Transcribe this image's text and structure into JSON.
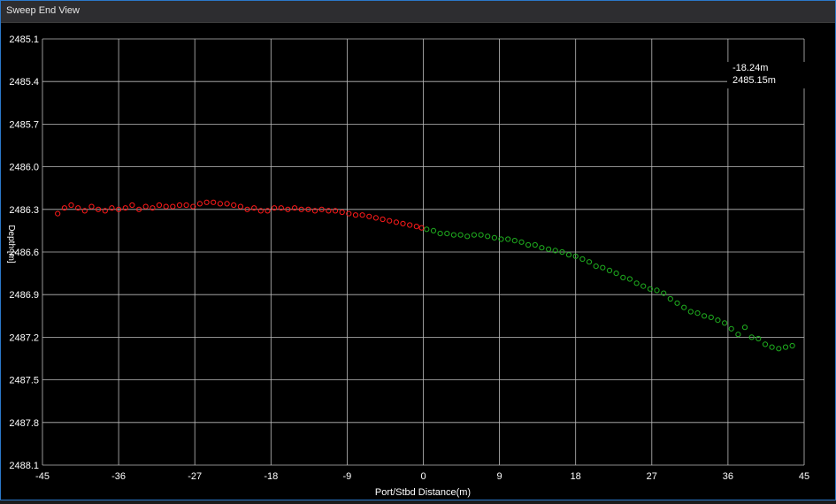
{
  "window": {
    "title": "Sweep End View"
  },
  "readout": {
    "x_text": "-18.24m",
    "y_text": "2485.15m"
  },
  "colors": {
    "background": "#000000",
    "grid": "#bdbdbd",
    "port_series": "#ff1a1a",
    "starboard_series": "#1fae1f",
    "text": "#ffffff"
  },
  "chart_data": {
    "type": "scatter",
    "xlabel": "Port/Stbd Distance(m)",
    "ylabel": "Depth [m]",
    "xlim": [
      -45,
      45
    ],
    "ylim": [
      2485.1,
      2488.1
    ],
    "y_inverted": true,
    "grid": true,
    "x_ticks": [
      "-45",
      "-36",
      "-27",
      "-18",
      "-9",
      "0",
      "9",
      "18",
      "27",
      "36",
      "45"
    ],
    "y_ticks": [
      "2485.1",
      "2485.4",
      "2485.7",
      "2486.0",
      "2486.3",
      "2486.6",
      "2486.9",
      "2487.2",
      "2487.5",
      "2487.8",
      "2488.1"
    ],
    "series": [
      {
        "color": "#ff1a1a",
        "x": [
          -43.2,
          -42.4,
          -41.6,
          -40.8,
          -40.0,
          -39.2,
          -38.4,
          -37.6,
          -36.8,
          -36.0,
          -35.2,
          -34.4,
          -33.6,
          -32.8,
          -32.0,
          -31.2,
          -30.4,
          -29.6,
          -28.8,
          -28.0,
          -27.2,
          -26.4,
          -25.6,
          -24.8,
          -24.0,
          -23.2,
          -22.4,
          -21.6,
          -20.8,
          -20.0,
          -19.2,
          -18.4,
          -17.6,
          -16.8,
          -16.0,
          -15.2,
          -14.4,
          -13.6,
          -12.8,
          -12.0,
          -11.2,
          -10.4,
          -9.6,
          -8.8,
          -8.0,
          -7.2,
          -6.4,
          -5.6,
          -4.8,
          -4.0,
          -3.2,
          -2.4,
          -1.6,
          -0.8,
          -0.2
        ],
        "y": [
          2486.33,
          2486.29,
          2486.27,
          2486.29,
          2486.31,
          2486.28,
          2486.3,
          2486.31,
          2486.29,
          2486.3,
          2486.29,
          2486.27,
          2486.3,
          2486.28,
          2486.29,
          2486.27,
          2486.28,
          2486.28,
          2486.27,
          2486.27,
          2486.28,
          2486.26,
          2486.25,
          2486.25,
          2486.26,
          2486.26,
          2486.27,
          2486.28,
          2486.3,
          2486.29,
          2486.31,
          2486.31,
          2486.29,
          2486.29,
          2486.3,
          2486.29,
          2486.3,
          2486.3,
          2486.31,
          2486.3,
          2486.31,
          2486.31,
          2486.32,
          2486.33,
          2486.34,
          2486.34,
          2486.35,
          2486.36,
          2486.37,
          2486.38,
          2486.39,
          2486.4,
          2486.41,
          2486.42,
          2486.43
        ]
      },
      {
        "color": "#1fae1f",
        "x": [
          0.4,
          1.2,
          2.0,
          2.8,
          3.6,
          4.4,
          5.2,
          6.0,
          6.8,
          7.6,
          8.4,
          9.2,
          10.0,
          10.8,
          11.6,
          12.4,
          13.2,
          14.0,
          14.8,
          15.6,
          16.4,
          17.2,
          18.0,
          18.8,
          19.6,
          20.4,
          21.2,
          22.0,
          22.8,
          23.6,
          24.4,
          25.2,
          26.0,
          26.8,
          27.6,
          28.4,
          29.2,
          30.0,
          30.8,
          31.6,
          32.4,
          33.2,
          34.0,
          34.8,
          35.6,
          36.4,
          37.2,
          38.0,
          38.8,
          39.6,
          40.4,
          41.2,
          42.0,
          42.8,
          43.6
        ],
        "y": [
          2486.44,
          2486.45,
          2486.47,
          2486.47,
          2486.48,
          2486.48,
          2486.49,
          2486.48,
          2486.48,
          2486.49,
          2486.5,
          2486.51,
          2486.51,
          2486.52,
          2486.53,
          2486.55,
          2486.55,
          2486.57,
          2486.58,
          2486.59,
          2486.6,
          2486.62,
          2486.63,
          2486.65,
          2486.67,
          2486.7,
          2486.71,
          2486.73,
          2486.75,
          2486.78,
          2486.79,
          2486.82,
          2486.84,
          2486.86,
          2486.87,
          2486.89,
          2486.93,
          2486.96,
          2486.99,
          2487.02,
          2487.03,
          2487.05,
          2487.06,
          2487.08,
          2487.1,
          2487.14,
          2487.18,
          2487.13,
          2487.2,
          2487.21,
          2487.25,
          2487.27,
          2487.28,
          2487.27,
          2487.26
        ]
      }
    ]
  }
}
